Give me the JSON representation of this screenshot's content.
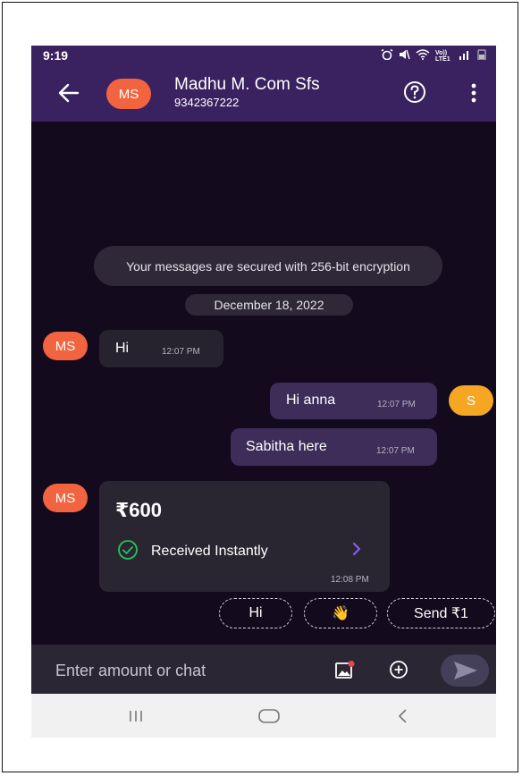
{
  "status_bar": {
    "time": "9:19",
    "network_label": "Vo)) LTE1"
  },
  "header": {
    "avatar_initials": "MS",
    "contact_name": "Madhu M. Com Sfs",
    "contact_phone": "9342367222"
  },
  "chat": {
    "security_notice": "Your messages are secured with 256-bit encryption",
    "date": "December 18, 2022",
    "messages": [
      {
        "direction": "incoming",
        "avatar": "MS",
        "text": "Hi",
        "time": "12:07 PM"
      },
      {
        "direction": "outgoing",
        "avatar": "S",
        "text": "Hi anna",
        "time": "12:07 PM"
      },
      {
        "direction": "outgoing",
        "text": "Sabitha here",
        "time": "12:07 PM"
      }
    ],
    "payment": {
      "avatar": "MS",
      "amount": "₹600",
      "status": "Received Instantly",
      "time": "12:08 PM"
    }
  },
  "quick_replies": [
    {
      "label": "Hi"
    },
    {
      "label": "👋"
    },
    {
      "label": "Send ₹1"
    }
  ],
  "input": {
    "placeholder": "Enter amount or chat"
  },
  "colors": {
    "header_bg": "#3a2160",
    "chat_bg": "#140a1e",
    "avatar_ms": "#f2643f",
    "avatar_s": "#f5a623",
    "outgoing_bubble": "#3d2d58",
    "incoming_bubble": "#26222e",
    "success_green": "#22c55e",
    "accent_purple": "#8b5cf6"
  },
  "icons": [
    "back-arrow-icon",
    "help-icon",
    "more-vert-icon",
    "check-circle-icon",
    "chevron-right-icon",
    "gallery-icon",
    "add-circle-icon",
    "send-icon",
    "recents-icon",
    "home-icon",
    "back-nav-icon"
  ]
}
